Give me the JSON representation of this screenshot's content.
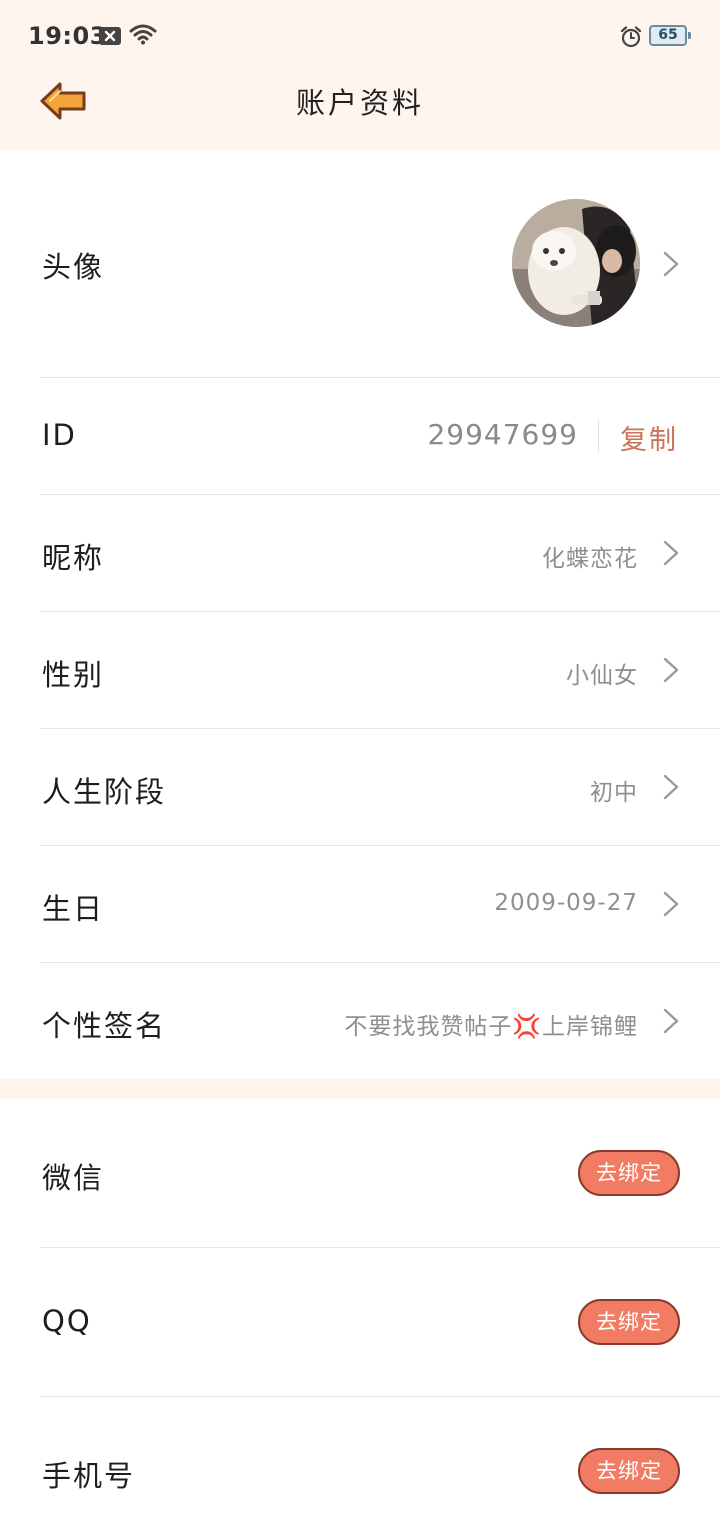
{
  "status_bar": {
    "time": "19:03",
    "battery": "65",
    "icons": [
      "notification-x-icon",
      "wifi-icon",
      "alarm-icon",
      "battery-icon"
    ]
  },
  "header": {
    "back_icon": "back-arrow-icon",
    "title": "账户资料"
  },
  "profile": {
    "avatar_label": "头像",
    "id_label": "ID",
    "id_value": "29947699",
    "copy_label": "复制",
    "nickname_label": "昵称",
    "nickname_value": "化蝶恋花",
    "gender_label": "性别",
    "gender_value": "小仙女",
    "stage_label": "人生阶段",
    "stage_value": "初中",
    "birthday_label": "生日",
    "birthday_value": "2009-09-27",
    "signature_label": "个性签名",
    "signature_value": "不要找我赞帖子💢上岸锦鲤"
  },
  "bindings": {
    "wechat_label": "微信",
    "qq_label": "QQ",
    "phone_label": "手机号",
    "bind_button_label": "去绑定"
  },
  "colors": {
    "header_bg": "#fdf5ee",
    "accent": "#c9735a",
    "bind_button": "#f27c63"
  }
}
